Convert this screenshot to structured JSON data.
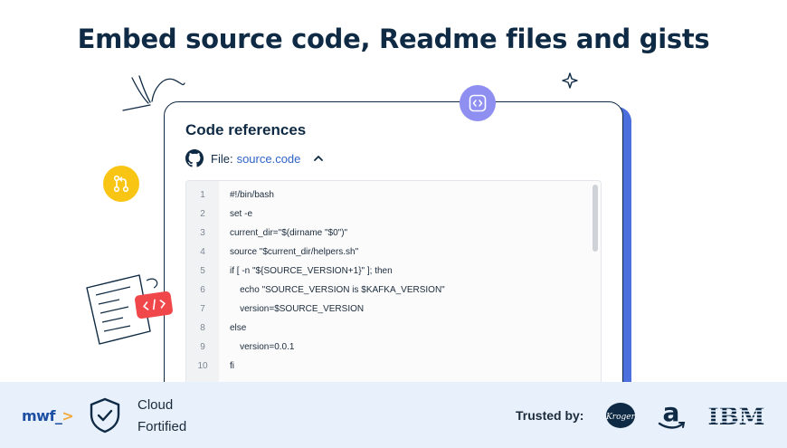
{
  "headline": "Embed source code, Readme files and gists",
  "card": {
    "title": "Code references",
    "file_label": "File:",
    "file_name": "source.code"
  },
  "code": {
    "lines": [
      {
        "n": "1",
        "text": "#!/bin/bash"
      },
      {
        "n": "2",
        "text": "set -e"
      },
      {
        "n": "3",
        "text": "current_dir=\"$(dirname \"$0\")\""
      },
      {
        "n": "4",
        "text": "source \"$current_dir/helpers.sh\""
      },
      {
        "n": "5",
        "text": "if [ -n \"${SOURCE_VERSION+1}\" ]; then"
      },
      {
        "n": "6",
        "text": "    echo \"SOURCE_VERSION is $KAFKA_VERSION\""
      },
      {
        "n": "7",
        "text": "    version=$SOURCE_VERSION"
      },
      {
        "n": "8",
        "text": "else"
      },
      {
        "n": "9",
        "text": "    version=0.0.1"
      },
      {
        "n": "10",
        "text": "fi"
      }
    ]
  },
  "footer": {
    "logo_main": "mwf_",
    "logo_accent": ">",
    "cloud_line1": "Cloud",
    "cloud_line2": "Fortified",
    "trusted_label": "Trusted by:",
    "brand_kroger": "Kroger",
    "brand_amazon": "a",
    "brand_ibm": "IBM"
  },
  "icons": {
    "embed": "code-embed-icon",
    "git": "git-pull-request-icon",
    "github": "github-icon",
    "chevron": "chevron-up-icon",
    "shield": "shield-check-icon"
  },
  "colors": {
    "navy": "#0f2a44",
    "link": "#2f64c7",
    "accent_blue": "#4b6fdc",
    "badge_purple": "#8e8ff0",
    "badge_yellow": "#f9c514",
    "code_red": "#f0474a",
    "footer_bg": "#e7f0fb",
    "logo_orange": "#f3a93b"
  }
}
